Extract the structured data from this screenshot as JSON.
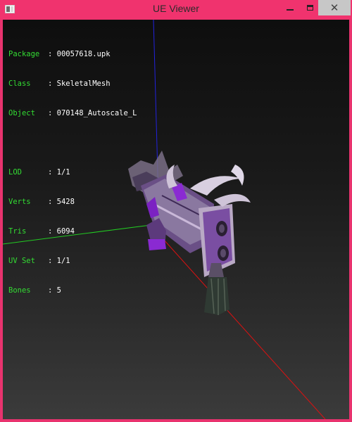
{
  "window": {
    "title": "UE Viewer",
    "close_glyph": "✕"
  },
  "info": {
    "rows_top": [
      {
        "label": "Package",
        "value": "00057618.upk"
      },
      {
        "label": "Class",
        "value": "SkeletalMesh"
      },
      {
        "label": "Object",
        "value": "070148_Autoscale_L"
      }
    ],
    "rows_bottom": [
      {
        "label": "LOD",
        "value": "1/1"
      },
      {
        "label": "Verts",
        "value": "5428"
      },
      {
        "label": "Tris",
        "value": "6094"
      },
      {
        "label": "UV Set",
        "value": "1/1"
      },
      {
        "label": "Bones",
        "value": "5"
      }
    ]
  },
  "colors": {
    "frame": "#e8336e",
    "axis_x": "#dd1111",
    "axis_y": "#22cc22",
    "axis_z": "#2222dd",
    "label": "#33dd33",
    "value": "#ffffff"
  },
  "icons": {
    "app": "app-icon",
    "minimize": "minimize-icon",
    "maximize": "maximize-icon",
    "close": "close-icon"
  }
}
